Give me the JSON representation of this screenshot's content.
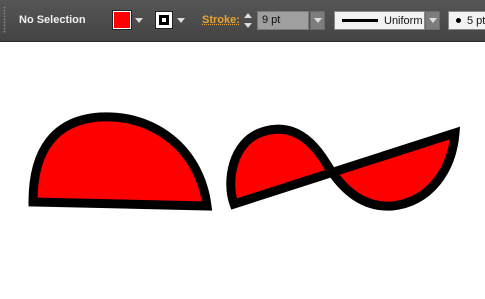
{
  "control_bar": {
    "selection_status": "No Selection",
    "fill": {
      "color": "#ff0000",
      "icon": "fill-swatch"
    },
    "stroke_swatch": {
      "color": "#000000",
      "icon": "stroke-swatch"
    },
    "stroke_label": "Stroke:",
    "stroke_weight": "9 pt",
    "variable_width_profile": "Uniform",
    "brush_definition": "5 pt"
  },
  "canvas": {
    "shapes": [
      {
        "name": "half-dome-shape",
        "fill": "#ff0000",
        "stroke": "#000000"
      },
      {
        "name": "wave-shape",
        "fill": "#ff0000",
        "stroke": "#000000"
      }
    ]
  },
  "colors": {
    "toolbar_bg": "#4d4d4d",
    "label_text": "#f0f0f0",
    "stroke_label_accent": "#e8a330",
    "shape_fill": "#ff0000",
    "shape_stroke": "#000000"
  }
}
